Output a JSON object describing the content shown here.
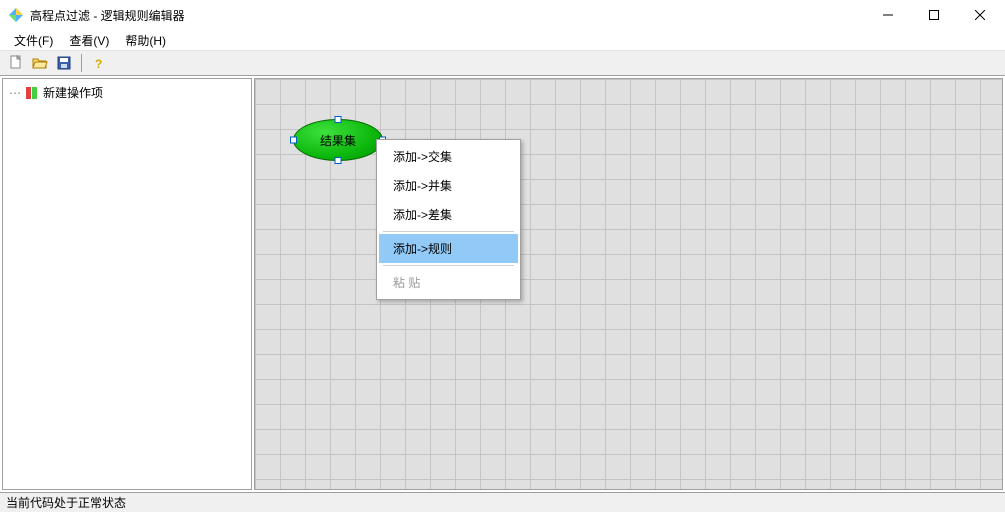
{
  "window": {
    "title": "高程点过滤 - 逻辑规则编辑器"
  },
  "menu": {
    "file": "文件(F)",
    "view": "查看(V)",
    "help": "帮助(H)"
  },
  "tree": {
    "root": "新建操作项"
  },
  "node": {
    "label": "结果集"
  },
  "context": {
    "items": {
      "0": "添加->交集",
      "1": "添加->并集",
      "2": "添加->差集",
      "3": "添加->规则",
      "4": "粘  贴"
    }
  },
  "status": {
    "text": "当前代码处于正常状态"
  }
}
